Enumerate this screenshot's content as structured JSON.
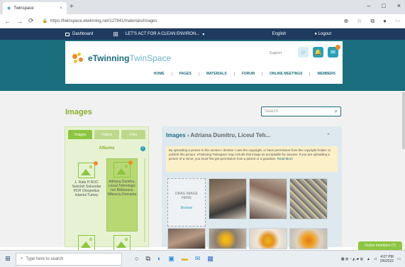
{
  "browser": {
    "tab_title": "Twinspace",
    "url": "https://twinspace.etwinning.net/127841/materials/images",
    "window_controls": [
      "–",
      "□",
      "×"
    ]
  },
  "site": {
    "dashboard_label": "Dashboard",
    "project_title": "LET'S ACT FOR A CLEAN ENVIRON...",
    "language": "English",
    "logout": "Logout",
    "logo_primary": "eTwinning",
    "logo_secondary": "TwinSpace",
    "support": "Support",
    "menu": [
      "HOME",
      "PAGES",
      "MATERIALS",
      "FORUM",
      "ONLINE MEETINGS",
      "MEMBERS"
    ]
  },
  "page": {
    "title": "Images",
    "search_placeholder": "Search",
    "tabs": [
      "Images",
      "Videos",
      "Files"
    ],
    "albums_label": "Albums",
    "albums": [
      {
        "label": "1. Rata H ROC Sekolah Sekundar PDH Ortopedius Istantul Turkey"
      },
      {
        "label": "Adriana Dumitru, Liceul Tehnologic Ion Bălăcescu Măneciu Romania"
      }
    ],
    "panel_title": "Images",
    "panel_subtitle": "› Adriana Dumitru, Liceul Teh...",
    "notice": "By uploading a picture in this section I declare I own the copyright, or have permission from the copyright holder, to publish this picture. eTwinning Twinspace may include this image as acceptable for anyone. If you are uploading a picture of a minor, you must first get permission from a parent or a guardian.",
    "notice_more": "Read More",
    "drop_text": "DRAG IMAGE HERE",
    "drop_link": "Browse",
    "chat": "Online members (7)"
  },
  "taskbar": {
    "search_placeholder": "Type here to search",
    "time": "4:07 PM",
    "date": "2/6/2021"
  }
}
